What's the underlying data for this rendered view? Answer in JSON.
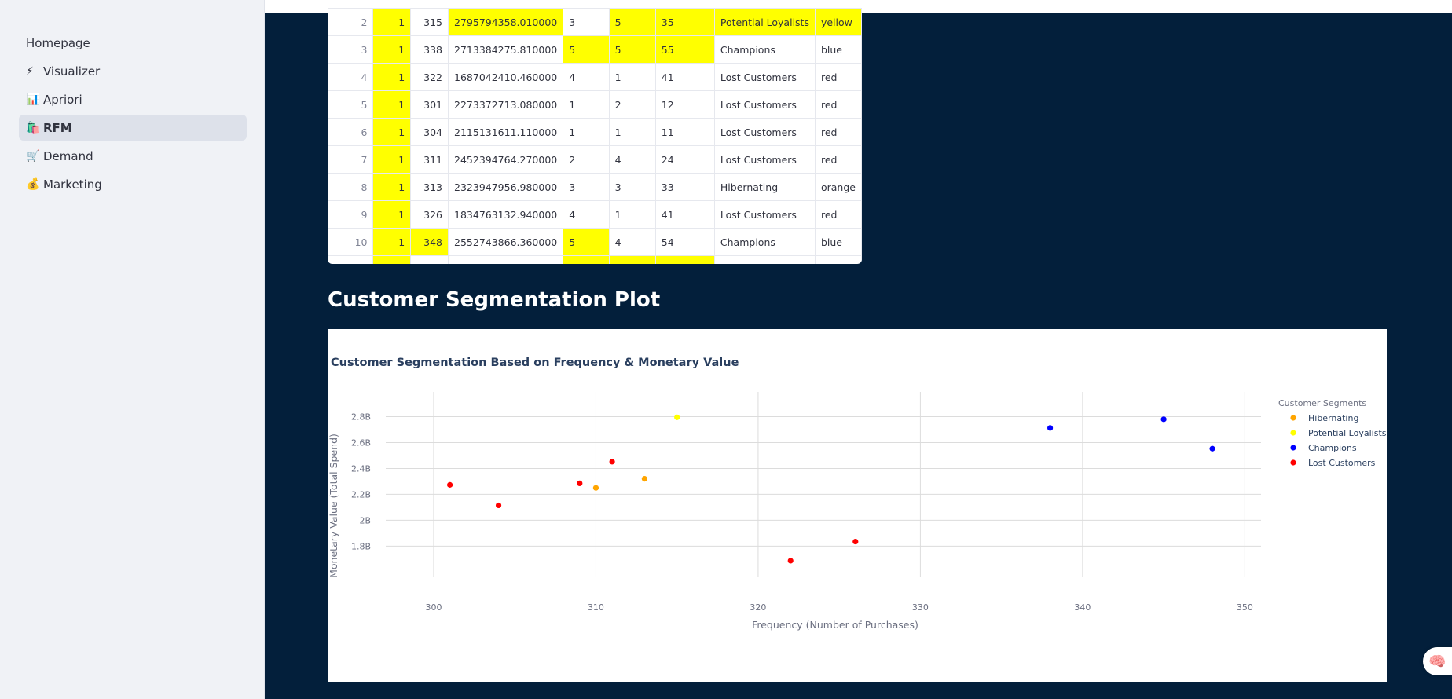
{
  "sidebar": {
    "items": [
      {
        "icon": "",
        "label": "Homepage",
        "active": false,
        "icon_name": "none"
      },
      {
        "icon": "⚡",
        "label": "Visualizer",
        "active": false,
        "icon_name": "lightning-icon"
      },
      {
        "icon": "📊",
        "label": "Apriori",
        "active": false,
        "icon_name": "bar-chart-icon"
      },
      {
        "icon": "🛍️",
        "label": "RFM",
        "active": true,
        "icon_name": "shopping-bags-icon"
      },
      {
        "icon": "🛒",
        "label": "Demand",
        "active": false,
        "icon_name": "shopping-cart-icon"
      },
      {
        "icon": "💰",
        "label": "Marketing",
        "active": false,
        "icon_name": "money-bag-icon"
      }
    ]
  },
  "table": {
    "highlight_color": "#ffff00",
    "rows": [
      [
        "2",
        "1",
        "315",
        "2795794358.010000",
        "3",
        "5",
        "35",
        "Potential Loyalists",
        "yellow"
      ],
      [
        "3",
        "1",
        "338",
        "2713384275.810000",
        "5",
        "5",
        "55",
        "Champions",
        "blue"
      ],
      [
        "4",
        "1",
        "322",
        "1687042410.460000",
        "4",
        "1",
        "41",
        "Lost Customers",
        "red"
      ],
      [
        "5",
        "1",
        "301",
        "2273372713.080000",
        "1",
        "2",
        "12",
        "Lost Customers",
        "red"
      ],
      [
        "6",
        "1",
        "304",
        "2115131611.110000",
        "1",
        "1",
        "11",
        "Lost Customers",
        "red"
      ],
      [
        "7",
        "1",
        "311",
        "2452394764.270000",
        "2",
        "4",
        "24",
        "Lost Customers",
        "red"
      ],
      [
        "8",
        "1",
        "313",
        "2323947956.980000",
        "3",
        "3",
        "33",
        "Hibernating",
        "orange"
      ],
      [
        "9",
        "1",
        "326",
        "1834763132.940000",
        "4",
        "1",
        "41",
        "Lost Customers",
        "red"
      ],
      [
        "10",
        "1",
        "348",
        "2552743866.360000",
        "5",
        "4",
        "54",
        "Champions",
        "blue"
      ],
      [
        "",
        "",
        "",
        "",
        "",
        "",
        "",
        "",
        ""
      ]
    ],
    "highlights": [
      [
        1,
        3,
        5,
        6,
        7,
        8
      ],
      [
        1,
        4,
        5,
        6
      ],
      [
        1
      ],
      [
        1
      ],
      [
        1
      ],
      [
        1
      ],
      [
        1
      ],
      [
        1
      ],
      [
        1,
        2,
        4
      ],
      [
        1,
        4,
        5,
        6
      ]
    ]
  },
  "section_title": "Customer Segmentation Plot",
  "chart_data": {
    "type": "scatter",
    "title": "Customer Segmentation Based on Frequency & Monetary Value",
    "xlabel": "Frequency (Number of Purchases)",
    "ylabel": "Monetary Value (Total Spend)",
    "xlim": [
      298.5,
      351.0
    ],
    "ylim": [
      1.62,
      2.87
    ],
    "x_ticks": [
      300,
      310,
      320,
      330,
      340,
      350
    ],
    "y_ticks": [
      1.8,
      2.0,
      2.2,
      2.4,
      2.6,
      2.8
    ],
    "y_tick_labels": [
      "1.8B",
      "2B",
      "2.2B",
      "2.4B",
      "2.6B",
      "2.8B"
    ],
    "grid": true,
    "legend_title": "Customer Segments",
    "legend_position": "right",
    "series": [
      {
        "name": "Hibernating",
        "color": "#ffa500",
        "x": [
          310,
          313
        ],
        "y": [
          2.25,
          2.32
        ]
      },
      {
        "name": "Potential Loyalists",
        "color": "#ffff00",
        "x": [
          315
        ],
        "y": [
          2.795
        ]
      },
      {
        "name": "Champions",
        "color": "#0000ff",
        "x": [
          338,
          345,
          348
        ],
        "y": [
          2.713,
          2.78,
          2.553
        ]
      },
      {
        "name": "Lost Customers",
        "color": "#ff0000",
        "x": [
          301,
          304,
          309,
          311,
          322,
          326
        ],
        "y": [
          2.273,
          2.115,
          2.285,
          2.452,
          1.687,
          1.835
        ]
      }
    ]
  },
  "fab": {
    "icon_name": "brain-icon",
    "icon": "🧠"
  }
}
